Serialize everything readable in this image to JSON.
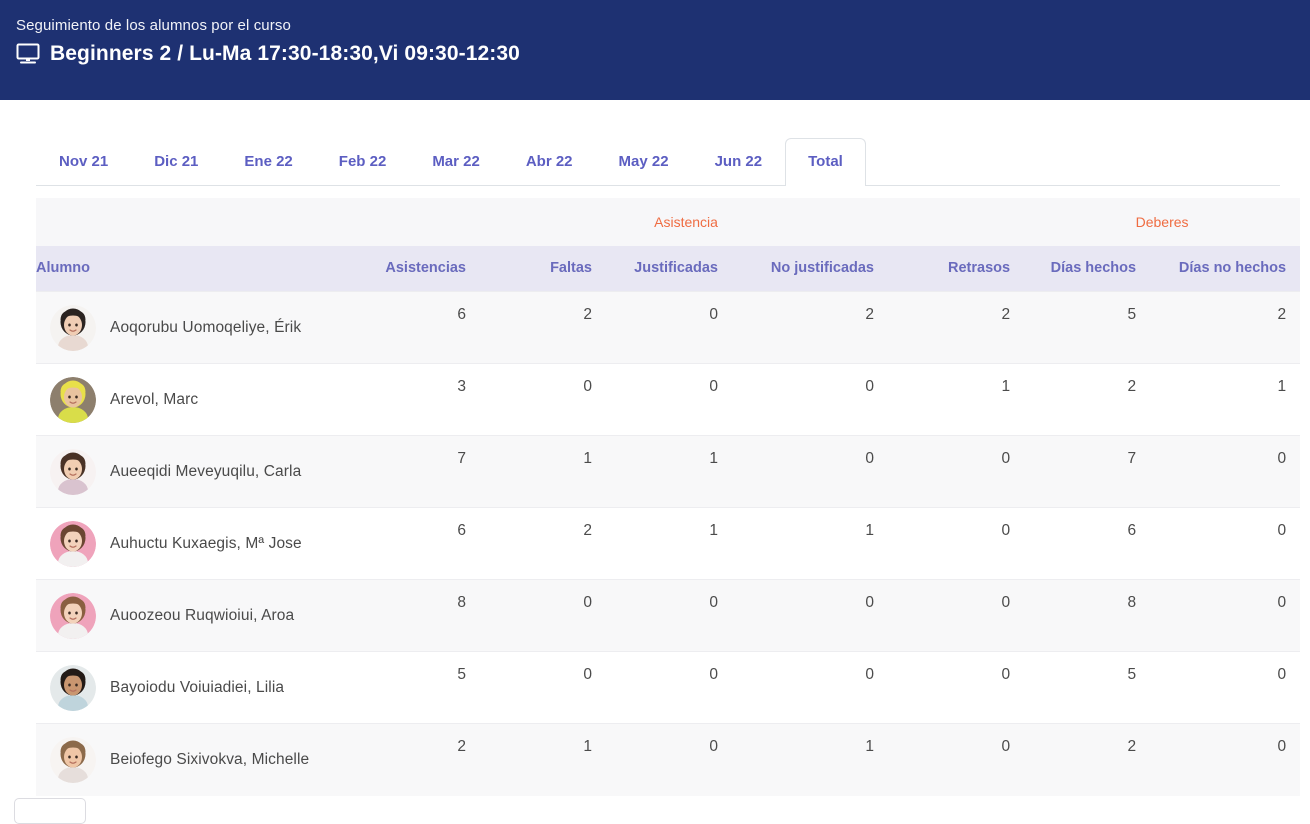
{
  "header": {
    "subtitle": "Seguimiento de los alumnos por el curso",
    "title": "Beginners 2 / Lu-Ma 17:30-18:30,Vi 09:30-12:30",
    "icon": "monitor-icon",
    "background_color": "#1e3172"
  },
  "tabs": {
    "active": "Total",
    "items": [
      {
        "label": "Nov 21",
        "active": false
      },
      {
        "label": "Dic 21",
        "active": false
      },
      {
        "label": "Ene 22",
        "active": false
      },
      {
        "label": "Feb 22",
        "active": false
      },
      {
        "label": "Mar 22",
        "active": false
      },
      {
        "label": "Abr 22",
        "active": false
      },
      {
        "label": "May 22",
        "active": false
      },
      {
        "label": "Jun 22",
        "active": false
      },
      {
        "label": "Total",
        "active": true
      }
    ],
    "color": "#5c5ec2"
  },
  "table": {
    "group_headers": {
      "blank": "",
      "asistencia": "Asistencia",
      "deberes": "Deberes",
      "color": "#ef6c42"
    },
    "columns": [
      "Alumno",
      "Asistencias",
      "Faltas",
      "Justificadas",
      "No justificadas",
      "Retrasos",
      "Días hechos",
      "Días no hechos"
    ],
    "header_color": "#6a6bbd",
    "rows": [
      {
        "name": "Aoqorubu Uomoqeliye, Érik",
        "avatar": "student-photo-avatar",
        "asistencias": "6",
        "faltas": "2",
        "justificadas": "0",
        "no_justificadas": "2",
        "retrasos": "2",
        "dias_hechos": "5",
        "dias_no_hechos": "2"
      },
      {
        "name": "Arevol, Marc",
        "avatar": "student-photo-avatar",
        "asistencias": "3",
        "faltas": "0",
        "justificadas": "0",
        "no_justificadas": "0",
        "retrasos": "1",
        "dias_hechos": "2",
        "dias_no_hechos": "1"
      },
      {
        "name": "Aueeqidi Meveyuqilu, Carla",
        "avatar": "student-photo-avatar",
        "asistencias": "7",
        "faltas": "1",
        "justificadas": "1",
        "no_justificadas": "0",
        "retrasos": "0",
        "dias_hechos": "7",
        "dias_no_hechos": "0"
      },
      {
        "name": "Auhuctu Kuxaegis, Mª Jose",
        "avatar": "student-photo-avatar",
        "asistencias": "6",
        "faltas": "2",
        "justificadas": "1",
        "no_justificadas": "1",
        "retrasos": "0",
        "dias_hechos": "6",
        "dias_no_hechos": "0"
      },
      {
        "name": "Auoozeou Ruqwioiui, Aroa",
        "avatar": "student-photo-avatar",
        "asistencias": "8",
        "faltas": "0",
        "justificadas": "0",
        "no_justificadas": "0",
        "retrasos": "0",
        "dias_hechos": "8",
        "dias_no_hechos": "0"
      },
      {
        "name": "Bayoiodu Voiuiadiei, Lilia",
        "avatar": "student-photo-avatar",
        "asistencias": "5",
        "faltas": "0",
        "justificadas": "0",
        "no_justificadas": "0",
        "retrasos": "0",
        "dias_hechos": "5",
        "dias_no_hechos": "0"
      },
      {
        "name": "Beiofego Sixivokva, Michelle",
        "avatar": "student-photo-avatar",
        "asistencias": "2",
        "faltas": "1",
        "justificadas": "0",
        "no_justificadas": "1",
        "retrasos": "0",
        "dias_hechos": "2",
        "dias_no_hechos": "0"
      }
    ]
  }
}
